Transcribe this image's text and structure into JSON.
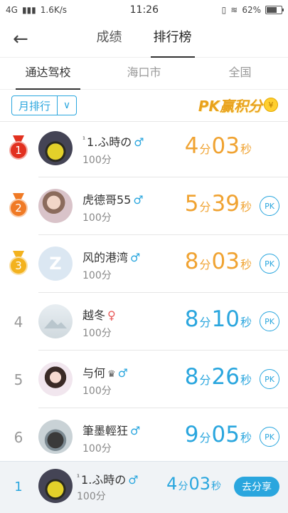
{
  "status_bar": {
    "network": "4G",
    "speed": "1.6K/s",
    "time": "11:26",
    "battery": "62%"
  },
  "header": {
    "tabs": [
      "成绩",
      "排行榜"
    ]
  },
  "scope_tabs": [
    "通达驾校",
    "海口市",
    "全国"
  ],
  "filter": {
    "selected": "月排行",
    "pk_banner": "PK赢积分",
    "coin_symbol": "¥"
  },
  "ranking": [
    {
      "rank": "1",
      "name": "1.ふ時の",
      "sup": "¹",
      "gender": "♂",
      "score": "100分",
      "time": {
        "min": "4",
        "sec": "03"
      },
      "color": "orange",
      "pk": ""
    },
    {
      "rank": "2",
      "name": "虎德哥55",
      "sup": "",
      "gender": "♂",
      "score": "100分",
      "time": {
        "min": "5",
        "sec": "39"
      },
      "color": "orange",
      "pk": "PK"
    },
    {
      "rank": "3",
      "name": "风的港湾",
      "sup": "",
      "gender": "♂",
      "score": "100分",
      "time": {
        "min": "8",
        "sec": "03"
      },
      "color": "orange",
      "pk": "PK"
    },
    {
      "rank": "4",
      "name": "越冬",
      "sup": "",
      "gender": "♀",
      "score": "100分",
      "time": {
        "min": "8",
        "sec": "10"
      },
      "color": "blue",
      "pk": "PK"
    },
    {
      "rank": "5",
      "name": "与何",
      "sup": "",
      "gender": "♂",
      "crown": "♛",
      "score": "100分",
      "time": {
        "min": "8",
        "sec": "26"
      },
      "color": "blue",
      "pk": "PK"
    },
    {
      "rank": "6",
      "name": "筆墨輕狂",
      "sup": "",
      "gender": "♂",
      "score": "100分",
      "time": {
        "min": "9",
        "sec": "05"
      },
      "color": "blue",
      "pk": "PK"
    }
  ],
  "units": {
    "min": "分",
    "sec": "秒"
  },
  "my_rank": {
    "rank": "1",
    "sup": "¹",
    "name": "1.ふ時の",
    "gender": "♂",
    "score": "100分",
    "time": {
      "min": "4",
      "sec": "03"
    },
    "share_label": "去分享"
  },
  "colors": {
    "accent": "#2aa6de",
    "orange": "#f0a332",
    "gold_medal": "#e2301f",
    "silver_medal": "#f07a25",
    "bronze_medal": "#f3b21e"
  }
}
